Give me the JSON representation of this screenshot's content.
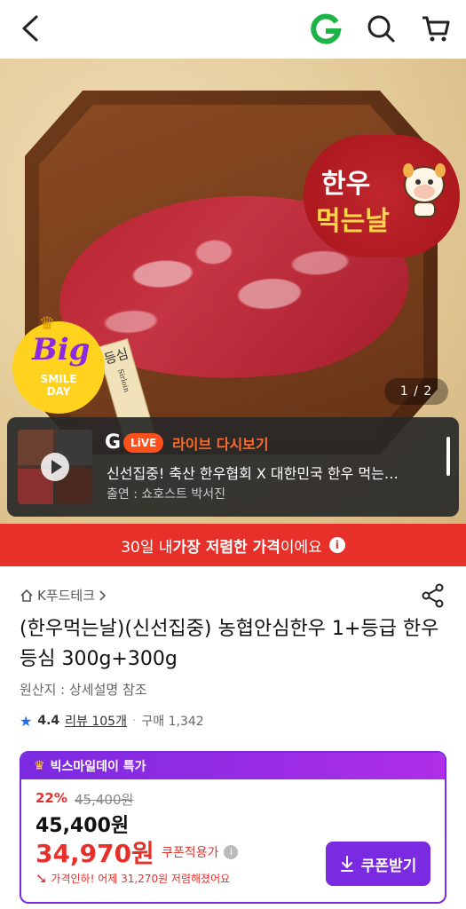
{
  "header": {
    "brand_letter": "G"
  },
  "hero": {
    "badge_line1": "한우",
    "badge_line2": "먹는날",
    "big_smile_big": "Big",
    "big_smile_small1": "SMILE",
    "big_smile_small2": "DAY",
    "tag_text": "등심",
    "tag_sub": "Sirloin",
    "pager": "1 / 2"
  },
  "live": {
    "g_letter": "G",
    "live_pill": "LiVE",
    "title": "라이브 다시보기",
    "description": "신선집중! 축산 한우협회 X 대한민국 한우 먹는…",
    "host": "출연 : 쇼호스트 박서진"
  },
  "red_strip": {
    "prefix": "30일 내 ",
    "bold": "가장 저렴한 가격",
    "suffix": "이에요"
  },
  "product": {
    "seller": "K푸드테크",
    "title": "(한우먹는날)(신선집중) 농협안심한우 1+등급 한우 등심 300g+300g",
    "origin": "원산지 : 상세설명 참조",
    "rating": "4.4",
    "reviews": "리뷰 105개",
    "purchases": "구매 1,342"
  },
  "price_card": {
    "header": "빅스마일데이 특가",
    "discount_pct": "22%",
    "original_price": "45,400원",
    "price": "45,400원",
    "coupon_price": "34,970원",
    "coupon_label": "쿠폰적용가",
    "price_drop": "가격인하! 어제 31,270원 저렴해졌어요",
    "coupon_button": "쿠폰받기"
  },
  "colors": {
    "accent_red": "#e8302b",
    "accent_purple": "#7a2ae0",
    "live_orange": "#ff6a2a"
  }
}
